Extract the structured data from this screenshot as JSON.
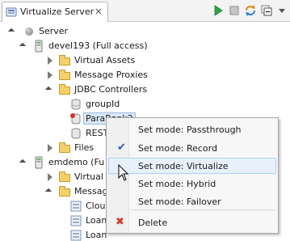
{
  "tab": {
    "title": "Virtualize Server",
    "close": "×"
  },
  "toolbar": {
    "play_icon": "play-icon",
    "stop_icon": "stop-icon",
    "refresh_icon": "refresh-icon",
    "collapse_icon": "collapse-icon"
  },
  "tree": {
    "server": "Server",
    "devel": "devel193 (Full access)",
    "virtual_assets": "Virtual Assets",
    "message_proxies": "Message Proxies",
    "jdbc_controllers": "JDBC Controllers",
    "groupId": "groupId",
    "parabank": "ParaBank2",
    "rest": "REST",
    "files": "Files",
    "emdemo": "emdemo (Fu",
    "virtual_a": "Virtual A",
    "message": "Message",
    "cloud": "Cloud",
    "loan1": "Loan",
    "loan2": "Loan"
  },
  "menu": {
    "passthrough": "Set mode: Passthrough",
    "record": "Set mode: Record",
    "virtualize": "Set mode: Virtualize",
    "hybrid": "Set mode: Hybrid",
    "failover": "Set mode: Failover",
    "delete": "Delete",
    "check_glyph": "✔",
    "delete_glyph": "✖"
  }
}
